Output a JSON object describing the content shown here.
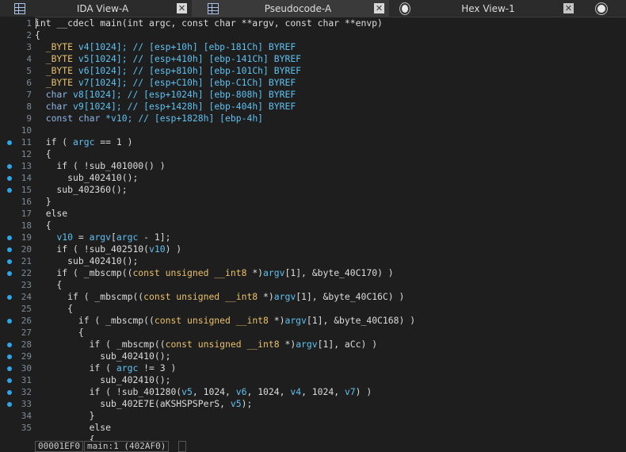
{
  "tabs": [
    {
      "label": "IDA View-A",
      "icon": "grid-icon",
      "active": false
    },
    {
      "label": "Pseudocode-A",
      "icon": "grid-icon",
      "active": true
    },
    {
      "label": "",
      "icon": "stack-icon",
      "active": false
    },
    {
      "label": "Hex View-1",
      "icon": "",
      "active": false
    },
    {
      "label": "",
      "icon": "structures-icon",
      "active": false
    }
  ],
  "lines": [
    {
      "n": "1",
      "dot": false,
      "toks": [
        [
          "int __cdecl main(int argc, const char **argv, const char **envp)",
          "plain"
        ]
      ]
    },
    {
      "n": "2",
      "dot": false,
      "toks": [
        [
          "{",
          "plain"
        ]
      ]
    },
    {
      "n": "3",
      "dot": false,
      "toks": [
        [
          "  ",
          "plain"
        ],
        [
          "_BYTE",
          "yellow"
        ],
        [
          " v4[1024]; ",
          "var"
        ],
        [
          "// [esp+10h] [ebp-181Ch] BYREF",
          "comment"
        ]
      ]
    },
    {
      "n": "4",
      "dot": false,
      "toks": [
        [
          "  ",
          "plain"
        ],
        [
          "_BYTE",
          "yellow"
        ],
        [
          " v5[1024]; ",
          "var"
        ],
        [
          "// [esp+410h] [ebp-141Ch] BYREF",
          "comment"
        ]
      ]
    },
    {
      "n": "5",
      "dot": false,
      "toks": [
        [
          "  ",
          "plain"
        ],
        [
          "_BYTE",
          "yellow"
        ],
        [
          " v6[1024]; ",
          "var"
        ],
        [
          "// [esp+810h] [ebp-101Ch] BYREF",
          "comment"
        ]
      ]
    },
    {
      "n": "6",
      "dot": false,
      "toks": [
        [
          "  ",
          "plain"
        ],
        [
          "_BYTE",
          "yellow"
        ],
        [
          " v7[1024]; ",
          "var"
        ],
        [
          "// [esp+C10h] [ebp-C1Ch] BYREF",
          "comment"
        ]
      ]
    },
    {
      "n": "7",
      "dot": false,
      "toks": [
        [
          "  ",
          "plain"
        ],
        [
          "char",
          "type"
        ],
        [
          " v8[1024]; ",
          "var"
        ],
        [
          "// [esp+1024h] [ebp-808h] BYREF",
          "comment"
        ]
      ]
    },
    {
      "n": "8",
      "dot": false,
      "toks": [
        [
          "  ",
          "plain"
        ],
        [
          "char",
          "type"
        ],
        [
          " v9[1024]; ",
          "var"
        ],
        [
          "// [esp+1428h] [ebp-404h] BYREF",
          "comment"
        ]
      ]
    },
    {
      "n": "9",
      "dot": false,
      "toks": [
        [
          "  ",
          "plain"
        ],
        [
          "const char",
          "type"
        ],
        [
          " *v10; ",
          "var"
        ],
        [
          "// [esp+1828h] [ebp-4h]",
          "comment"
        ]
      ]
    },
    {
      "n": "10",
      "dot": false,
      "toks": [
        [
          "",
          "plain"
        ]
      ]
    },
    {
      "n": "11",
      "dot": true,
      "toks": [
        [
          "  if ( ",
          "plain"
        ],
        [
          "argc",
          "var"
        ],
        [
          " == 1 )",
          "plain"
        ]
      ]
    },
    {
      "n": "12",
      "dot": false,
      "toks": [
        [
          "  {",
          "plain"
        ]
      ]
    },
    {
      "n": "13",
      "dot": true,
      "toks": [
        [
          "    if ( !sub_401000() )",
          "plain"
        ]
      ]
    },
    {
      "n": "14",
      "dot": true,
      "toks": [
        [
          "      sub_402410();",
          "plain"
        ]
      ]
    },
    {
      "n": "15",
      "dot": true,
      "toks": [
        [
          "    sub_402360();",
          "plain"
        ]
      ]
    },
    {
      "n": "16",
      "dot": false,
      "toks": [
        [
          "  }",
          "plain"
        ]
      ]
    },
    {
      "n": "17",
      "dot": false,
      "toks": [
        [
          "  else",
          "plain"
        ]
      ]
    },
    {
      "n": "18",
      "dot": false,
      "toks": [
        [
          "  {",
          "plain"
        ]
      ]
    },
    {
      "n": "19",
      "dot": true,
      "toks": [
        [
          "    ",
          "plain"
        ],
        [
          "v10",
          "var"
        ],
        [
          " = ",
          "plain"
        ],
        [
          "argv",
          "var"
        ],
        [
          "[",
          "plain"
        ],
        [
          "argc",
          "var"
        ],
        [
          " - 1];",
          "plain"
        ]
      ]
    },
    {
      "n": "20",
      "dot": true,
      "toks": [
        [
          "    if ( !sub_402510(",
          "plain"
        ],
        [
          "v10",
          "var"
        ],
        [
          ") )",
          "plain"
        ]
      ]
    },
    {
      "n": "21",
      "dot": true,
      "toks": [
        [
          "      sub_402410();",
          "plain"
        ]
      ]
    },
    {
      "n": "22",
      "dot": true,
      "toks": [
        [
          "    if ( _mbscmp((",
          "plain"
        ],
        [
          "const unsigned __int8",
          "yellow"
        ],
        [
          " *)",
          "plain"
        ],
        [
          "argv",
          "var"
        ],
        [
          "[1], &byte_40C170) )",
          "plain"
        ]
      ]
    },
    {
      "n": "23",
      "dot": false,
      "toks": [
        [
          "    {",
          "plain"
        ]
      ]
    },
    {
      "n": "24",
      "dot": true,
      "toks": [
        [
          "      if ( _mbscmp((",
          "plain"
        ],
        [
          "const unsigned __int8",
          "yellow"
        ],
        [
          " *)",
          "plain"
        ],
        [
          "argv",
          "var"
        ],
        [
          "[1], &byte_40C16C) )",
          "plain"
        ]
      ]
    },
    {
      "n": "25",
      "dot": false,
      "toks": [
        [
          "      {",
          "plain"
        ]
      ]
    },
    {
      "n": "26",
      "dot": true,
      "toks": [
        [
          "        if ( _mbscmp((",
          "plain"
        ],
        [
          "const unsigned __int8",
          "yellow"
        ],
        [
          " *)",
          "plain"
        ],
        [
          "argv",
          "var"
        ],
        [
          "[1], &byte_40C168) )",
          "plain"
        ]
      ]
    },
    {
      "n": "27",
      "dot": false,
      "toks": [
        [
          "        {",
          "plain"
        ]
      ]
    },
    {
      "n": "28",
      "dot": true,
      "toks": [
        [
          "          if ( _mbscmp((",
          "plain"
        ],
        [
          "const unsigned __int8",
          "yellow"
        ],
        [
          " *)",
          "plain"
        ],
        [
          "argv",
          "var"
        ],
        [
          "[1], aCc) )",
          "plain"
        ]
      ]
    },
    {
      "n": "29",
      "dot": true,
      "toks": [
        [
          "            sub_402410();",
          "plain"
        ]
      ]
    },
    {
      "n": "30",
      "dot": true,
      "toks": [
        [
          "          if ( ",
          "plain"
        ],
        [
          "argc",
          "var"
        ],
        [
          " != 3 )",
          "plain"
        ]
      ]
    },
    {
      "n": "31",
      "dot": true,
      "toks": [
        [
          "            sub_402410();",
          "plain"
        ]
      ]
    },
    {
      "n": "32",
      "dot": true,
      "toks": [
        [
          "          if ( !sub_401280(",
          "plain"
        ],
        [
          "v5",
          "var"
        ],
        [
          ", 1024, ",
          "plain"
        ],
        [
          "v6",
          "var"
        ],
        [
          ", 1024, ",
          "plain"
        ],
        [
          "v4",
          "var"
        ],
        [
          ", 1024, ",
          "plain"
        ],
        [
          "v7",
          "var"
        ],
        [
          ") )",
          "plain"
        ]
      ]
    },
    {
      "n": "33",
      "dot": true,
      "toks": [
        [
          "            sub_402E7E(aKSHSPSPerS, ",
          "plain"
        ],
        [
          "v5",
          "var"
        ],
        [
          ");",
          "plain"
        ]
      ]
    },
    {
      "n": "34",
      "dot": false,
      "toks": [
        [
          "          }",
          "plain"
        ]
      ]
    },
    {
      "n": "35",
      "dot": false,
      "toks": [
        [
          "          else",
          "plain"
        ]
      ]
    },
    {
      "n": "",
      "dot": false,
      "toks": [
        [
          "          {",
          "plain"
        ]
      ]
    }
  ],
  "statusbar": {
    "address": "00001EF0",
    "location": "main:1 (402AF0)"
  }
}
